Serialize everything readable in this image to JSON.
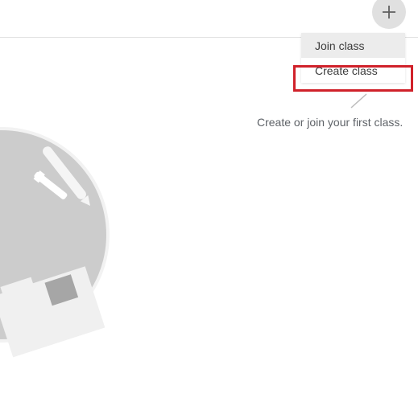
{
  "header": {
    "add_icon": "plus-icon"
  },
  "menu": {
    "items": [
      {
        "label": "Join class"
      },
      {
        "label": "Create class"
      }
    ]
  },
  "empty_state": {
    "hint": "Create or join your first class."
  },
  "colors": {
    "highlight": "#d0212a",
    "illustration_circle": "#cccccc",
    "menu_hover": "#ececec"
  }
}
